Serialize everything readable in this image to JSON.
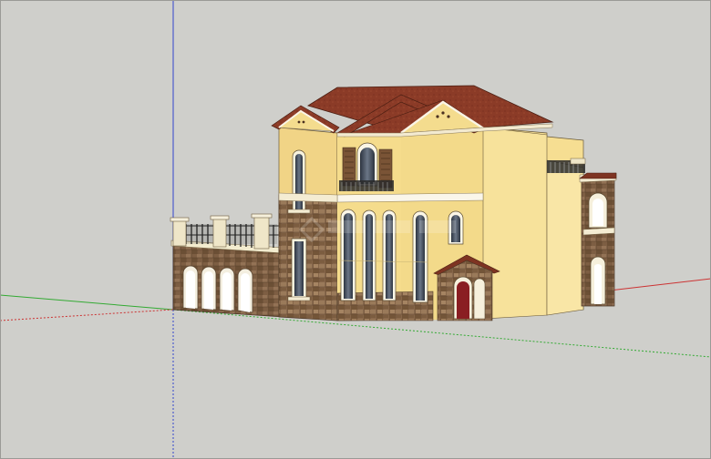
{
  "viewport": {
    "background": "#cfcfcb"
  },
  "axes": {
    "x_axis_color": "#cc3333",
    "y_axis_color": "#33aa33",
    "z_axis_color": "#3344cc"
  },
  "model": {
    "wall_color": "#f5dc8c",
    "stone_color": "#8a6a4e",
    "roof_color": "#8a3a26",
    "trim_color": "#f8f4e6"
  }
}
